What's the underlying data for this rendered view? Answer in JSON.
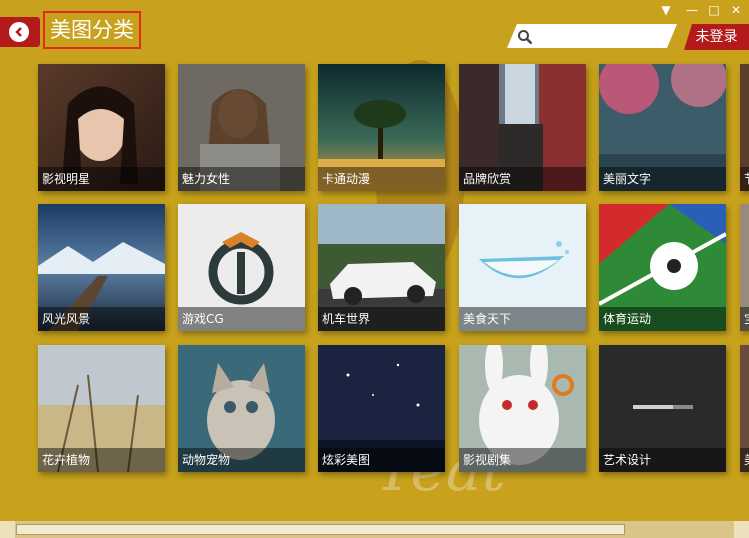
{
  "header": {
    "title": "美图分类",
    "back_icon": "back-arrow-icon",
    "search_placeholder": "",
    "login_label": "未登录"
  },
  "window_controls": {
    "menu_icon": "▼",
    "min_icon": "—",
    "max_icon": "□",
    "close_icon": "✕"
  },
  "colors": {
    "background": "#c8a21c",
    "accent": "#b31b1b",
    "title_border": "#e02a1a"
  },
  "categories": [
    {
      "label": "影视明星"
    },
    {
      "label": "魅力女性"
    },
    {
      "label": "卡通动漫"
    },
    {
      "label": "品牌欣赏"
    },
    {
      "label": "美丽文字"
    },
    {
      "label": "节"
    },
    {
      "label": "风光风景"
    },
    {
      "label": "游戏CG"
    },
    {
      "label": "机车世界"
    },
    {
      "label": "美食天下"
    },
    {
      "label": "体育运动"
    },
    {
      "label": "宝"
    },
    {
      "label": "花卉植物"
    },
    {
      "label": "动物宠物"
    },
    {
      "label": "炫彩美图"
    },
    {
      "label": "影视剧集"
    },
    {
      "label": "艺术设计"
    },
    {
      "label": "美"
    }
  ],
  "scrollbar": {
    "thumb_fraction": 0.85
  }
}
